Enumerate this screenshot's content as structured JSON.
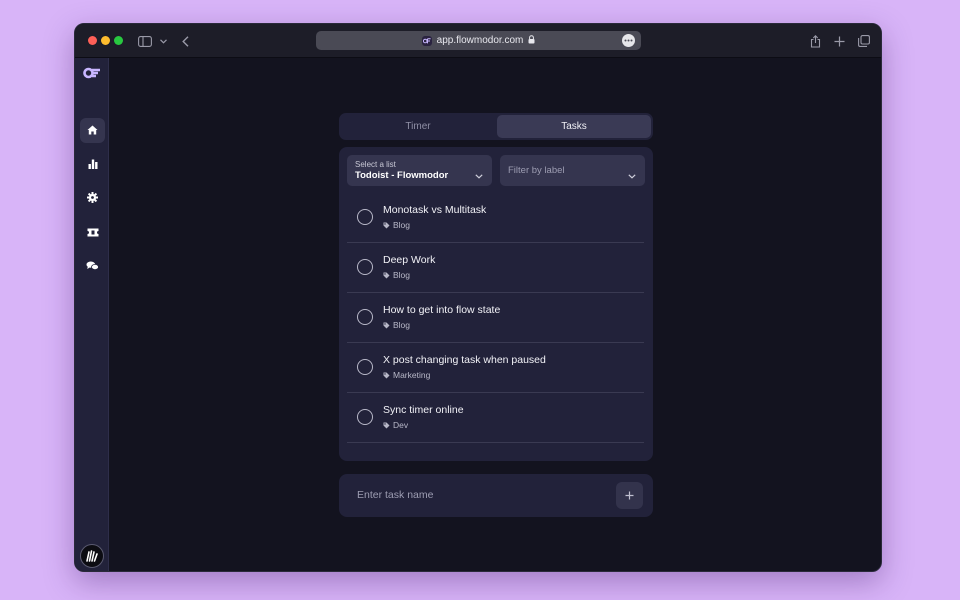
{
  "browser": {
    "url": "app.flowmodor.com"
  },
  "tabs": [
    {
      "label": "Timer",
      "active": false
    },
    {
      "label": "Tasks",
      "active": true
    }
  ],
  "list_select": {
    "caption": "Select a list",
    "value": "Todoist - Flowmodor"
  },
  "label_filter": {
    "placeholder": "Filter by label"
  },
  "tasks": [
    {
      "title": "Monotask vs Multitask",
      "label": "Blog"
    },
    {
      "title": "Deep Work",
      "label": "Blog"
    },
    {
      "title": "How to get into flow state",
      "label": "Blog"
    },
    {
      "title": "X post changing task when paused",
      "label": "Marketing"
    },
    {
      "title": "Sync timer online",
      "label": "Dev"
    }
  ],
  "new_task": {
    "placeholder": "Enter task name"
  },
  "sidebar": {
    "items": [
      "home-icon",
      "stats-icon",
      "settings-icon",
      "ticket-icon",
      "chat-icon"
    ]
  },
  "colors": {
    "background": "#d8b4f8",
    "window": "#13131f",
    "panel": "#22223a",
    "accent": "#c8b6ff"
  }
}
